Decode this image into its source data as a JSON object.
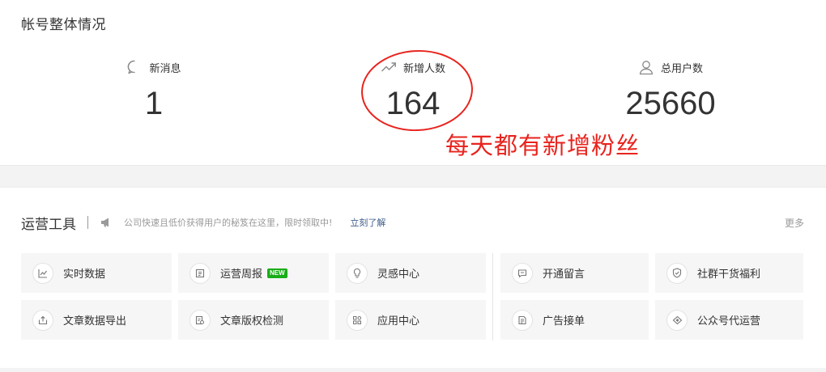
{
  "overview": {
    "title": "帐号整体情况",
    "stats": {
      "new_messages": {
        "label": "新消息",
        "value": "1",
        "icon": "message-icon"
      },
      "new_followers": {
        "label": "新增人数",
        "value": "164",
        "icon": "trend-up-icon"
      },
      "total_users": {
        "label": "总用户数",
        "value": "25660",
        "icon": "user-icon"
      }
    },
    "annotation": {
      "text": "每天都有新增粉丝",
      "color": "#e8231d"
    }
  },
  "tools": {
    "title": "运营工具",
    "promo_text": "公司快速且低价获得用户的秘笈在这里，限时领取中!",
    "promo_link": "立刻了解",
    "more": "更多",
    "new_badge": "NEW",
    "items": [
      {
        "label": "实时数据",
        "icon": "chart-icon"
      },
      {
        "label": "运营周报",
        "icon": "weekly-report-icon",
        "badge": "NEW"
      },
      {
        "label": "灵感中心",
        "icon": "lightbulb-icon"
      },
      {
        "label": "开通留言",
        "icon": "comment-icon"
      },
      {
        "label": "社群干货福利",
        "icon": "shield-check-icon"
      },
      {
        "label": "文章数据导出",
        "icon": "export-icon"
      },
      {
        "label": "文章版权检测",
        "icon": "copyright-check-icon"
      },
      {
        "label": "应用中心",
        "icon": "apps-grid-icon"
      },
      {
        "label": "广告接单",
        "icon": "ad-document-icon"
      },
      {
        "label": "公众号代运营",
        "icon": "diamond-tag-icon"
      }
    ]
  }
}
